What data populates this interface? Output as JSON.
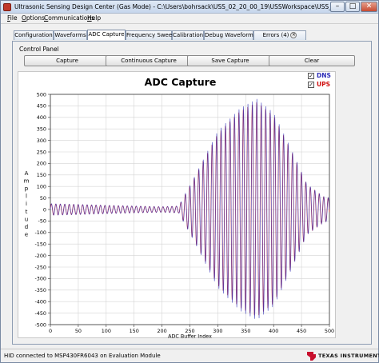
{
  "window": {
    "title": "Ultrasonic Sensing Design Center (Gas Mode) - C:\\Users\\bohrsack\\USS_02_20_00_19\\USSWorkspace\\USS_Project",
    "minimize": "–",
    "maximize": "□",
    "close": "✕"
  },
  "menu": [
    "File",
    "Options",
    "Communications",
    "Help"
  ],
  "tabs": [
    {
      "label": "Configuration",
      "active": false
    },
    {
      "label": "Waveforms",
      "active": false
    },
    {
      "label": "ADC Capture",
      "active": true
    },
    {
      "label": "Frequency Sweep",
      "active": false
    },
    {
      "label": "Calibration",
      "active": false
    },
    {
      "label": "Debug Waveform",
      "active": false
    },
    {
      "label": "Errors (4)",
      "active": false
    }
  ],
  "panel": {
    "section_label": "Control Panel",
    "buttons": [
      "Capture",
      "Continuous Capture",
      "Save Capture",
      "Clear"
    ]
  },
  "legend": [
    {
      "label": "DNS",
      "checked": true,
      "color": "#2e2eb8"
    },
    {
      "label": "UPS",
      "checked": true,
      "color": "#d01010"
    }
  ],
  "chart_data": {
    "type": "line",
    "title": "ADC Capture",
    "xlabel": "ADC Buffer Index",
    "ylabel": "Amplitude",
    "xlim": [
      0,
      500
    ],
    "ylim": [
      -500,
      500
    ],
    "xticks": [
      0,
      50,
      100,
      150,
      200,
      250,
      300,
      350,
      400,
      450,
      500
    ],
    "yticks": [
      500,
      450,
      400,
      350,
      300,
      250,
      200,
      150,
      100,
      50,
      0,
      -50,
      -100,
      -150,
      -200,
      -250,
      -300,
      -350,
      -400,
      -450,
      -500
    ],
    "grid": true,
    "envelope_x": [
      0,
      50,
      100,
      150,
      200,
      230,
      260,
      300,
      340,
      370,
      400,
      430,
      460,
      490,
      500
    ],
    "envelope_amplitude": [
      25,
      22,
      18,
      15,
      12,
      15,
      150,
      340,
      440,
      480,
      420,
      270,
      110,
      55,
      50
    ],
    "oscillation_period": 8,
    "series": [
      {
        "name": "DNS",
        "color": "#2e2eb8"
      },
      {
        "name": "UPS",
        "color": "#d01010"
      }
    ]
  },
  "status": {
    "text": "HID connected to MSP430FR6043 on Evaluation Module",
    "brand": "TEXAS INSTRUMENTS",
    "brand_color": "#c8102e"
  }
}
